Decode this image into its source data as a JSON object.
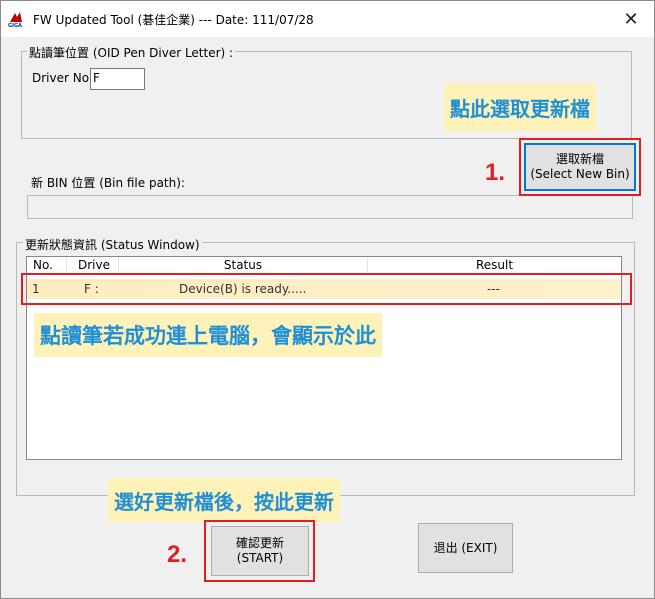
{
  "window": {
    "title": "FW Updated Tool (碁佳企業) --- Date: 111/07/28",
    "app_icon": "giga-logo-icon",
    "close_symbol": "✕"
  },
  "oid_group": {
    "label": "點讀筆位置 (OID Pen Diver Letter) :",
    "driver_label": "Driver No:",
    "driver_value": "F"
  },
  "bin_group": {
    "label": "新 BIN 位置 (Bin file path):",
    "path_value": "",
    "select_button": {
      "line1": "選取新檔",
      "line2": "(Select New Bin)"
    }
  },
  "status_group": {
    "label": "更新狀態資訊 (Status Window)",
    "columns": [
      "No.",
      "Drive",
      "Status",
      "Result"
    ],
    "rows": [
      {
        "no": "1",
        "drive": "F :",
        "status": "Device(B) is ready.....",
        "result": "---"
      }
    ]
  },
  "buttons": {
    "start": {
      "line1": "確認更新",
      "line2": "(START)"
    },
    "exit": "退出 (EXIT)"
  },
  "annotations": {
    "select_hint": "點此選取更新檔",
    "connect_hint": "點讀筆若成功連上電腦，會顯示於此",
    "start_hint": "選好更新檔後，按此更新",
    "step1": "1.",
    "step2": "2.",
    "highlight_color": "#e02020",
    "callout_bg": "#fff2b8",
    "callout_text_color": "#1f8fd6"
  }
}
